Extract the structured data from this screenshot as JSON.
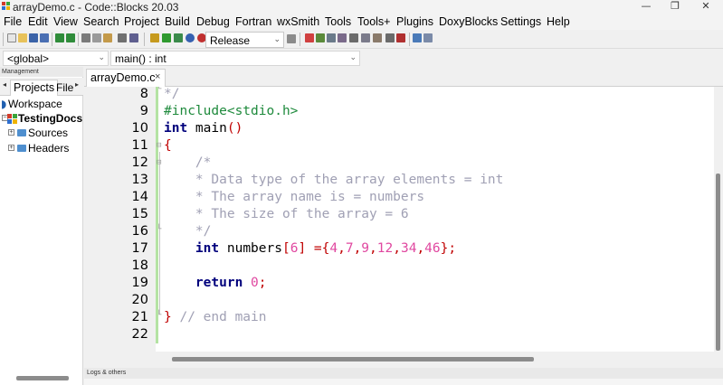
{
  "window": {
    "title": "arrayDemo.c - Code::Blocks 20.03",
    "controls": [
      "—",
      "❐",
      "✕"
    ]
  },
  "menu": [
    "File",
    "Edit",
    "View",
    "Search",
    "Project",
    "Build",
    "Debug",
    "Fortran",
    "wxSmith",
    "Tools",
    "Tools+",
    "Plugins",
    "DoxyBlocks",
    "Settings",
    "Help"
  ],
  "toolbar": {
    "build_target": "Release"
  },
  "scope": {
    "scope_value": "<global>",
    "function_value": "main() : int"
  },
  "management": {
    "title": "Management",
    "tabs": [
      "Projects",
      "File"
    ],
    "tree": {
      "workspace": "Workspace",
      "project": "TestingDocs",
      "folders": [
        "Sources",
        "Headers"
      ]
    }
  },
  "editor": {
    "tab_label": "arrayDemo.c",
    "tab_close": "×",
    "line_numbers": [
      "8",
      "9",
      "10",
      "11",
      "12",
      "13",
      "14",
      "15",
      "16",
      "17",
      "18",
      "19",
      "20",
      "21",
      "22"
    ]
  },
  "logs": {
    "title": "Logs & others"
  },
  "colors": {
    "keyword": "#00007c",
    "comment": "#a0a0b4",
    "preprocessor": "#1e8a3c",
    "number": "#e048a0",
    "operator": "#c00000",
    "change_bar": "#b4e3a3"
  }
}
